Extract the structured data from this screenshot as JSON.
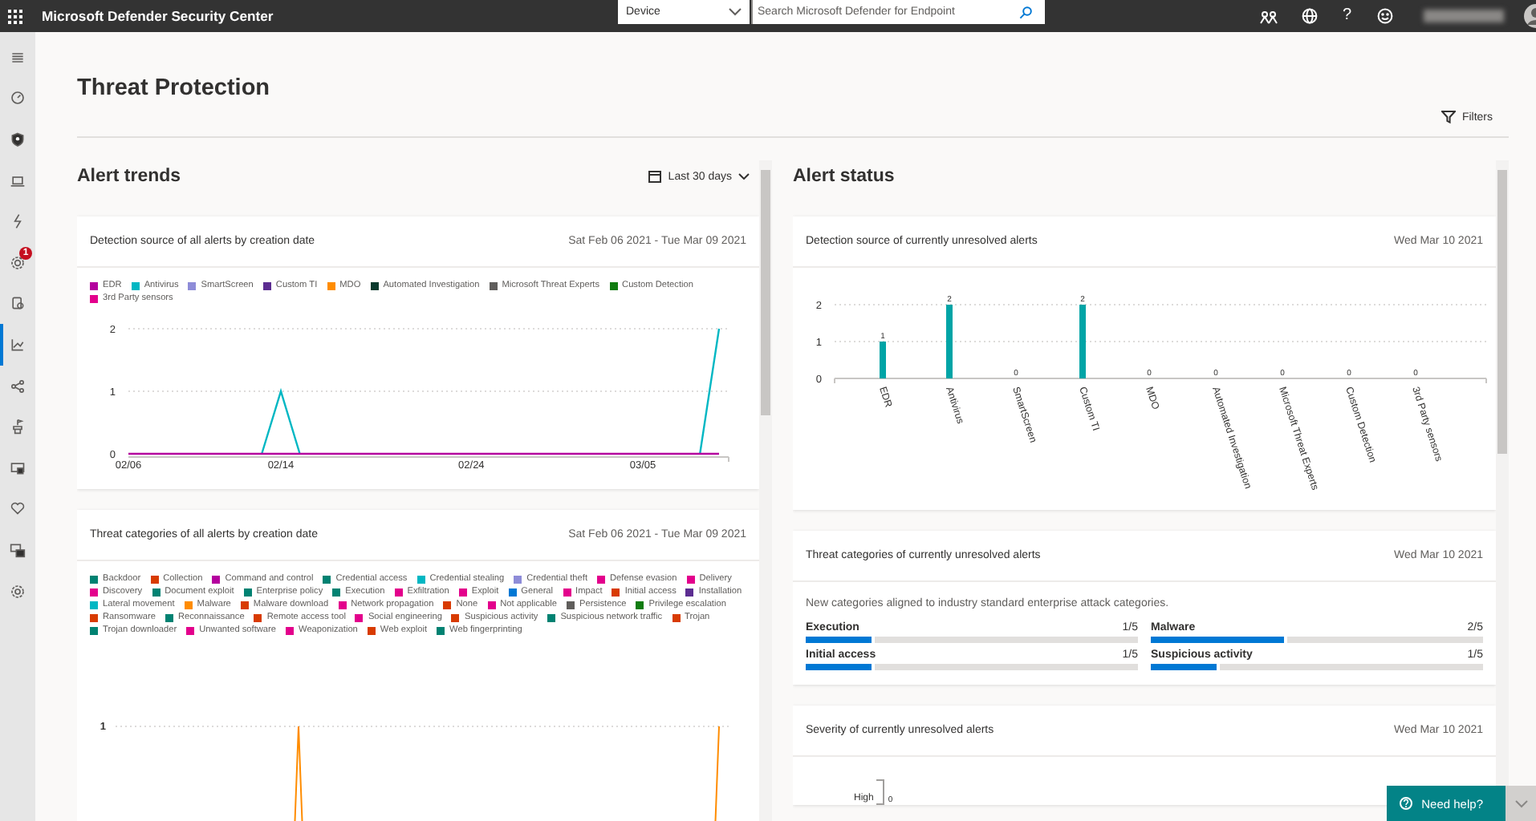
{
  "top_bar": {
    "title": "Microsoft Defender Security Center",
    "scope": "Device",
    "search": {
      "placeholder": "Search Microsoft Defender for Endpoint"
    },
    "help": "?"
  },
  "sidebar": {
    "items": [
      {
        "selected": false
      },
      {
        "selected": false
      },
      {
        "selected": false
      },
      {
        "selected": false
      },
      {
        "selected": false
      },
      {
        "selected": false,
        "badge": "1"
      },
      {
        "selected": false
      },
      {
        "selected": true
      },
      {
        "selected": false
      },
      {
        "selected": false
      },
      {
        "selected": false
      },
      {
        "selected": false
      },
      {
        "selected": false
      },
      {
        "selected": false
      }
    ]
  },
  "page_header": {
    "title": "Threat Protection",
    "filters_button": "Filters"
  },
  "alert_trends": {
    "title": "Alert trends",
    "range_picker": "Last 30 days",
    "detection_source": {
      "title": "Detection source of all alerts by creation date",
      "date_range": "Sat Feb 06 2021 - Tue Mar 09 2021",
      "chart_data": {
        "type": "line",
        "categories": [
          "02/06",
          null,
          null,
          null,
          null,
          null,
          null,
          null,
          "02/14",
          null,
          null,
          null,
          null,
          null,
          null,
          null,
          null,
          null,
          "02/24",
          null,
          null,
          null,
          null,
          null,
          null,
          null,
          null,
          "03/05",
          null,
          null,
          null,
          null
        ],
        "ylim": [
          0,
          2
        ],
        "yticks": [
          0,
          1,
          2
        ],
        "series": [
          {
            "name": "EDR",
            "color": "#b4009e",
            "values": [
              0,
              0,
              0,
              0,
              0,
              0,
              0,
              0,
              0,
              0,
              0,
              0,
              0,
              0,
              0,
              0,
              0,
              0,
              0,
              0,
              0,
              0,
              0,
              0,
              0,
              0,
              0,
              0,
              0,
              0,
              0,
              0
            ]
          },
          {
            "name": "Antivirus",
            "color": "#00b7c3",
            "values": [
              null,
              null,
              null,
              null,
              null,
              null,
              null,
              0,
              1,
              0,
              null,
              null,
              null,
              null,
              null,
              null,
              null,
              null,
              null,
              null,
              null,
              null,
              null,
              null,
              null,
              null,
              null,
              null,
              null,
              null,
              0,
              2
            ]
          },
          {
            "name": "SmartScreen",
            "color": "#8e8cd8",
            "values": [
              null,
              null,
              null,
              null,
              null,
              null,
              null,
              null,
              null,
              null,
              null,
              null,
              null,
              null,
              null,
              null,
              null,
              null,
              null,
              null,
              null,
              null,
              null,
              null,
              null,
              null,
              null,
              null,
              null,
              null,
              null,
              null
            ]
          },
          {
            "name": "Custom TI",
            "color": "#5c2d91",
            "values": [
              null,
              null,
              null,
              null,
              null,
              null,
              null,
              null,
              null,
              null,
              null,
              null,
              null,
              null,
              null,
              null,
              null,
              null,
              null,
              null,
              null,
              null,
              null,
              null,
              null,
              null,
              null,
              null,
              null,
              null,
              null,
              null
            ]
          },
          {
            "name": "MDO",
            "color": "#ff8c00",
            "values": [
              null,
              null,
              null,
              null,
              null,
              null,
              null,
              null,
              null,
              null,
              null,
              null,
              null,
              null,
              null,
              null,
              null,
              null,
              null,
              null,
              null,
              null,
              null,
              null,
              null,
              null,
              null,
              null,
              null,
              null,
              null,
              null
            ]
          },
          {
            "name": "Automated Investigation",
            "color": "#0b3a2e",
            "values": [
              null,
              null,
              null,
              null,
              null,
              null,
              null,
              null,
              null,
              null,
              null,
              null,
              null,
              null,
              null,
              null,
              null,
              null,
              null,
              null,
              null,
              null,
              null,
              null,
              null,
              null,
              null,
              null,
              null,
              null,
              null,
              null
            ]
          },
          {
            "name": "Microsoft Threat Experts",
            "color": "#605e5c",
            "values": [
              null,
              null,
              null,
              null,
              null,
              null,
              null,
              null,
              null,
              null,
              null,
              null,
              null,
              null,
              null,
              null,
              null,
              null,
              null,
              null,
              null,
              null,
              null,
              null,
              null,
              null,
              null,
              null,
              null,
              null,
              null,
              null
            ]
          },
          {
            "name": "Custom Detection",
            "color": "#107c10",
            "values": [
              null,
              null,
              null,
              null,
              null,
              null,
              null,
              null,
              null,
              null,
              null,
              null,
              null,
              null,
              null,
              null,
              null,
              null,
              null,
              null,
              null,
              null,
              null,
              null,
              null,
              null,
              null,
              null,
              null,
              null,
              null,
              null
            ]
          },
          {
            "name": "3rd Party sensors",
            "color": "#e3008c",
            "values": [
              null,
              null,
              null,
              null,
              null,
              null,
              null,
              null,
              null,
              null,
              null,
              null,
              null,
              null,
              null,
              null,
              null,
              null,
              null,
              null,
              null,
              null,
              null,
              null,
              null,
              null,
              null,
              null,
              null,
              null,
              null,
              null
            ]
          }
        ]
      }
    },
    "threat_categories": {
      "title": "Threat categories of all alerts by creation date",
      "date_range": "Sat Feb 06 2021 - Tue Mar 09 2021",
      "y_tick": "1",
      "legend": [
        {
          "name": "Backdoor",
          "color": "#008272"
        },
        {
          "name": "Collection",
          "color": "#d83b01"
        },
        {
          "name": "Command and control",
          "color": "#b4009e"
        },
        {
          "name": "Credential access",
          "color": "#008272"
        },
        {
          "name": "Credential stealing",
          "color": "#00b7c3"
        },
        {
          "name": "Credential theft",
          "color": "#8e8cd8"
        },
        {
          "name": "Defense evasion",
          "color": "#e3008c"
        },
        {
          "name": "Delivery",
          "color": "#e3008c"
        },
        {
          "name": "Discovery",
          "color": "#e3008c"
        },
        {
          "name": "Document exploit",
          "color": "#008272"
        },
        {
          "name": "Enterprise policy",
          "color": "#008272"
        },
        {
          "name": "Execution",
          "color": "#008272"
        },
        {
          "name": "Exfiltration",
          "color": "#e3008c"
        },
        {
          "name": "Exploit",
          "color": "#e3008c"
        },
        {
          "name": "General",
          "color": "#0078d4"
        },
        {
          "name": "Impact",
          "color": "#e3008c"
        },
        {
          "name": "Initial access",
          "color": "#d83b01"
        },
        {
          "name": "Installation",
          "color": "#5c2d91"
        },
        {
          "name": "Lateral movement",
          "color": "#00b7c3"
        },
        {
          "name": "Malware",
          "color": "#ff8c00"
        },
        {
          "name": "Malware download",
          "color": "#d83b01"
        },
        {
          "name": "Network propagation",
          "color": "#e3008c"
        },
        {
          "name": "None",
          "color": "#d83b01"
        },
        {
          "name": "Not applicable",
          "color": "#e3008c"
        },
        {
          "name": "Persistence",
          "color": "#605e5c"
        },
        {
          "name": "Privilege escalation",
          "color": "#107c10"
        },
        {
          "name": "Ransomware",
          "color": "#d83b01"
        },
        {
          "name": "Reconnaissance",
          "color": "#008272"
        },
        {
          "name": "Remote access tool",
          "color": "#d83b01"
        },
        {
          "name": "Social engineering",
          "color": "#e3008c"
        },
        {
          "name": "Suspicious activity",
          "color": "#d83b01"
        },
        {
          "name": "Suspicious network traffic",
          "color": "#008272"
        },
        {
          "name": "Trojan",
          "color": "#d83b01"
        },
        {
          "name": "Trojan downloader",
          "color": "#008272"
        },
        {
          "name": "Unwanted software",
          "color": "#e3008c"
        },
        {
          "name": "Weaponization",
          "color": "#e3008c"
        },
        {
          "name": "Web exploit",
          "color": "#d83b01"
        },
        {
          "name": "Web fingerprinting",
          "color": "#008272"
        }
      ]
    }
  },
  "alert_status": {
    "title": "Alert status",
    "detection_source": {
      "title": "Detection source of currently unresolved alerts",
      "date": "Wed Mar 10 2021",
      "chart_data": {
        "type": "bar",
        "categories": [
          "EDR",
          "Antivirus",
          "SmartScreen",
          "Custom TI",
          "MDO",
          "Automated Investigation",
          "Microsoft Threat Experts",
          "Custom Detection",
          "3rd Party sensors"
        ],
        "values": [
          1,
          2,
          0,
          2,
          0,
          0,
          0,
          0,
          0
        ],
        "ylim": [
          0,
          2
        ],
        "yticks": [
          0,
          1,
          2
        ],
        "data_labels": true
      }
    },
    "threat_categories": {
      "title": "Threat categories of currently unresolved alerts",
      "date": "Wed Mar 10 2021",
      "description": "New categories aligned to industry standard enterprise attack categories.",
      "items": [
        {
          "label": "Execution",
          "reading": "1/5",
          "level": 0.2
        },
        {
          "label": "Malware",
          "reading": "2/5",
          "level": 0.4
        },
        {
          "label": "Initial access",
          "reading": "1/5",
          "level": 0.2
        },
        {
          "label": "Suspicious activity",
          "reading": "1/5",
          "level": 0.2
        }
      ]
    },
    "severity": {
      "title": "Severity of currently unresolved alerts",
      "date": "Wed Mar 10 2021",
      "row_label": "High",
      "row_value": "0"
    }
  },
  "help_button": {
    "label": "Need help?"
  }
}
